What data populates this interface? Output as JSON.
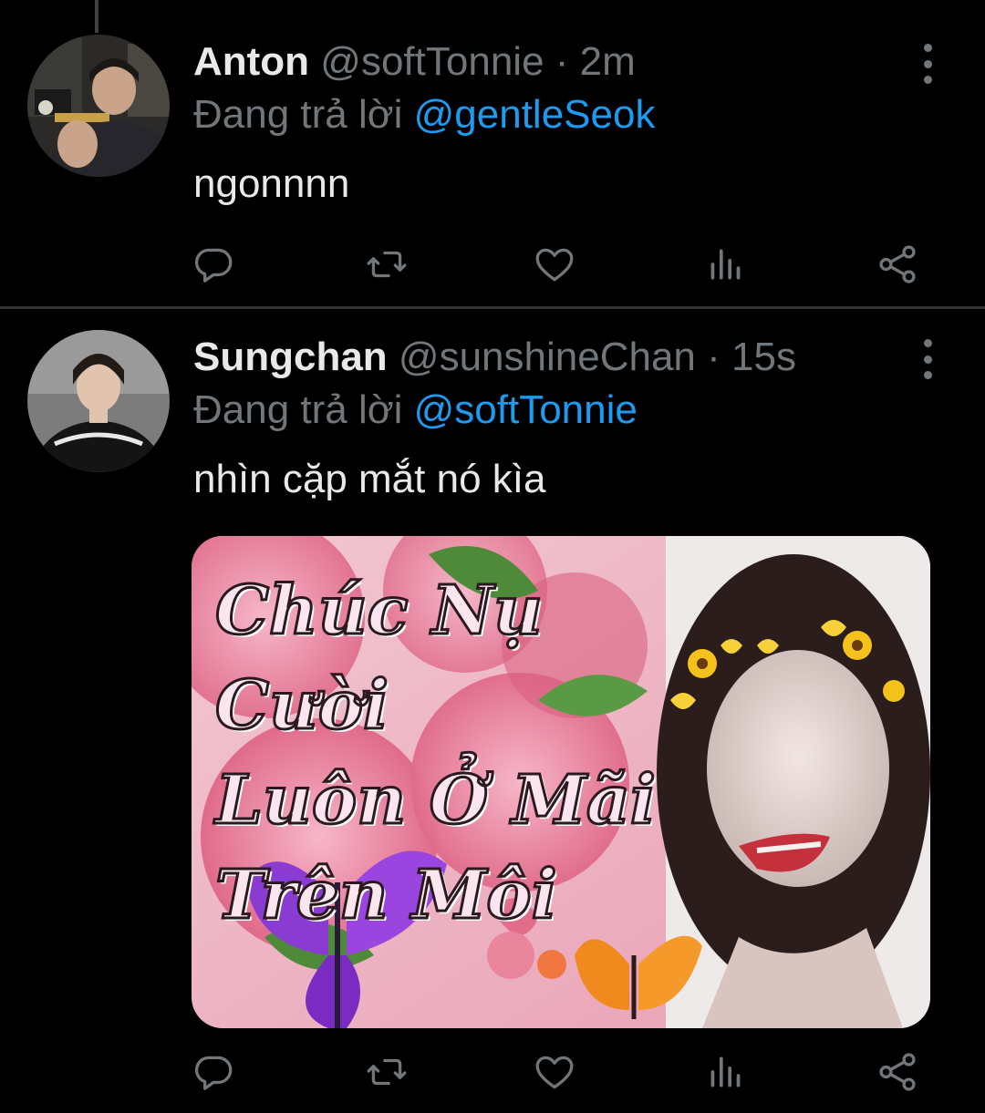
{
  "tweets": [
    {
      "name": "Anton",
      "handle": "@softTonnie",
      "separator": "·",
      "time": "2m",
      "replying_prefix": "Đang trả lời",
      "replying_to": "@gentleSeok",
      "text": "ngonnnn"
    },
    {
      "name": "Sungchan",
      "handle": "@sunshineChan",
      "separator": "·",
      "time": "15s",
      "replying_prefix": "Đang trả lời",
      "replying_to": "@softTonnie",
      "text": "nhìn cặp mắt nó kìa",
      "media": {
        "caption_lines": [
          "Chúc Nụ Cười",
          "Luôn Ở Mãi",
          "Trên Môi"
        ]
      }
    }
  ],
  "icons": {
    "actions": [
      "reply-icon",
      "retweet-icon",
      "like-icon",
      "views-icon",
      "share-icon"
    ],
    "more": "more-vertical-icon"
  },
  "colors": {
    "background": "#000000",
    "primary_text": "#e7e9ea",
    "secondary_text": "#71767b",
    "link": "#1d9bf0",
    "divider": "#2f3336"
  }
}
